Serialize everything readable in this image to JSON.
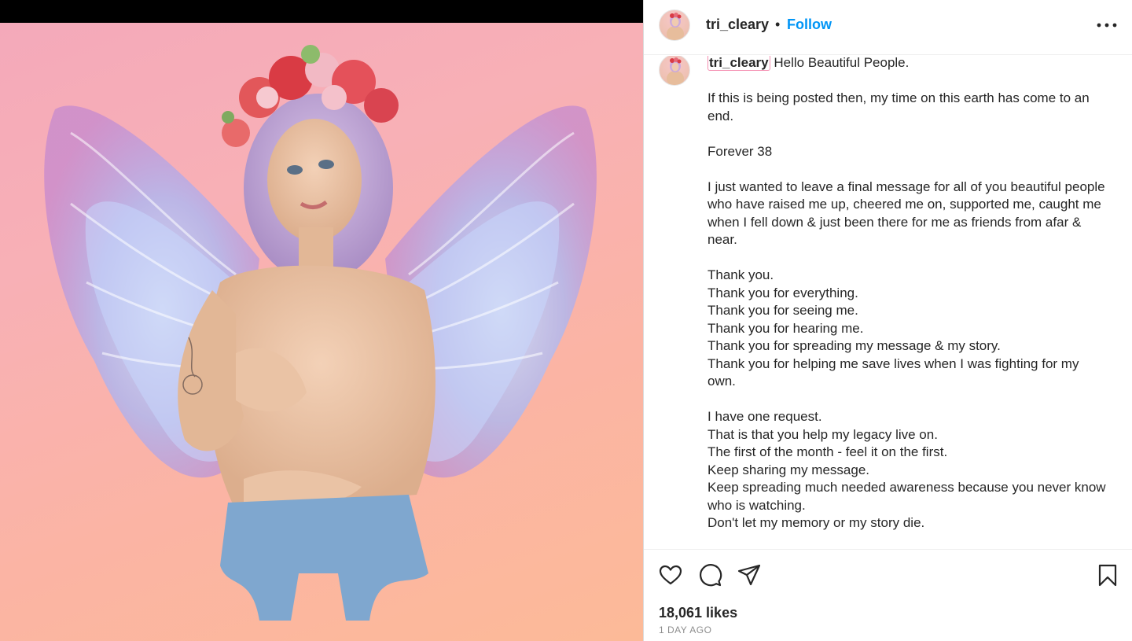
{
  "post": {
    "username": "tri_cleary",
    "separator": "•",
    "follow_label": "Follow",
    "more_icon": "more-horizontal-icon",
    "caption_intro": "Hello Beautiful People.",
    "caption_paragraphs": [
      [
        "If this is being posted then, my time on this earth has come to an end."
      ],
      [
        "Forever 38"
      ],
      [
        "I just wanted to leave a final message for all of you beautiful people who have raised me up, cheered me on, supported me, caught me when I fell down & just been there for me as friends from afar & near."
      ],
      [
        "Thank you.",
        "Thank you for everything.",
        "Thank you for seeing me.",
        "Thank you for hearing me.",
        "Thank you for spreading my message & my story.",
        "Thank you for helping me save lives when I was fighting for my own."
      ],
      [
        "I have one request.",
        "That is that you help my legacy live on.",
        "The first of the month - feel it on the first.",
        "Keep sharing my message.",
        "Keep spreading much needed awareness because you never know who is watching.",
        "Don't let my memory or my story die."
      ]
    ],
    "likes": "18,061 likes",
    "timestamp": "1 DAY AGO",
    "icons": {
      "like": "heart-icon",
      "comment": "comment-icon",
      "share": "paper-plane-icon",
      "save": "bookmark-icon"
    }
  },
  "colors": {
    "follow": "#0095f6",
    "text": "#262626",
    "muted": "#8e8e8e",
    "username_highlight": "#f48fb1"
  }
}
